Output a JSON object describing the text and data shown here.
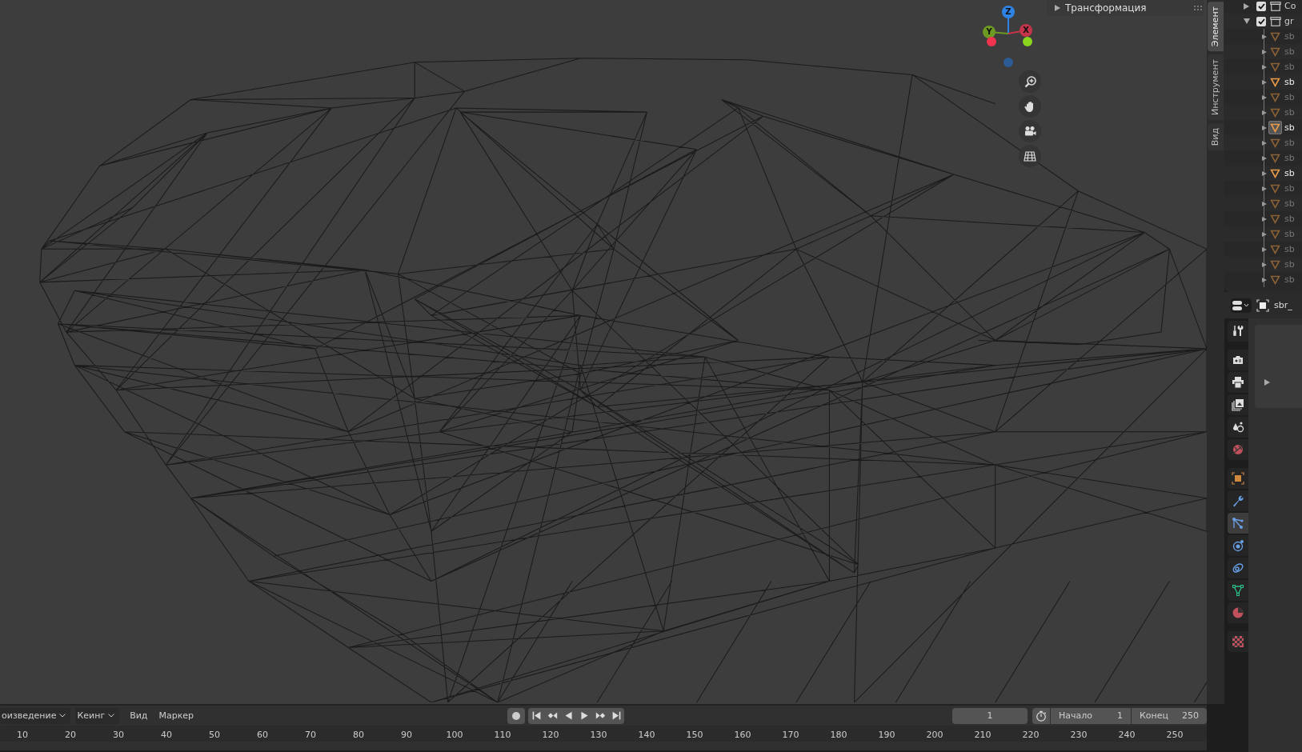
{
  "viewport": {
    "panel": {
      "title": "Трансформация",
      "expanded": false
    },
    "gizmo_axes": [
      {
        "label": "Z",
        "color": "#2f83e4"
      },
      {
        "label": "Y",
        "color": "#6c9a23"
      },
      {
        "label": "X",
        "color": "#c4354b"
      }
    ]
  },
  "sidebar_tabs": [
    {
      "label": "Элемент",
      "selected": true
    },
    {
      "label": "Инструмент",
      "selected": false
    },
    {
      "label": "Вид",
      "selected": false
    }
  ],
  "outliner": {
    "items": [
      {
        "name": "Co",
        "kind": "collection",
        "checked": true,
        "expanded": false
      },
      {
        "name": "gr",
        "kind": "collection",
        "checked": true,
        "expanded": true,
        "children": [
          {
            "name": "sb",
            "kind": "mesh",
            "selected": false,
            "active": false
          },
          {
            "name": "sb",
            "kind": "mesh",
            "selected": false,
            "active": false
          },
          {
            "name": "sb",
            "kind": "mesh",
            "selected": false,
            "active": false
          },
          {
            "name": "sb",
            "kind": "mesh",
            "selected": true,
            "active": false
          },
          {
            "name": "sb",
            "kind": "mesh",
            "selected": false,
            "active": false
          },
          {
            "name": "sb",
            "kind": "mesh",
            "selected": false,
            "active": false
          },
          {
            "name": "sb",
            "kind": "mesh",
            "selected": true,
            "active": true
          },
          {
            "name": "sb",
            "kind": "mesh",
            "selected": false,
            "active": false
          },
          {
            "name": "sb",
            "kind": "mesh",
            "selected": false,
            "active": false
          },
          {
            "name": "sb",
            "kind": "mesh",
            "selected": true,
            "active": false
          },
          {
            "name": "sb",
            "kind": "mesh",
            "selected": false,
            "active": false
          },
          {
            "name": "sb",
            "kind": "mesh",
            "selected": false,
            "active": false
          },
          {
            "name": "sb",
            "kind": "mesh",
            "selected": false,
            "active": false
          },
          {
            "name": "sb",
            "kind": "mesh",
            "selected": false,
            "active": false
          },
          {
            "name": "sb",
            "kind": "mesh",
            "selected": false,
            "active": false
          },
          {
            "name": "sb",
            "kind": "mesh",
            "selected": false,
            "active": false
          },
          {
            "name": "sb",
            "kind": "mesh",
            "selected": false,
            "active": false
          }
        ]
      }
    ]
  },
  "properties": {
    "object_name": "sbr_",
    "panel_expanded": false,
    "tabs": [
      {
        "kind": "tool",
        "selected": false
      },
      {
        "kind": "render",
        "selected": false
      },
      {
        "kind": "output",
        "selected": false
      },
      {
        "kind": "view_layer",
        "selected": false
      },
      {
        "kind": "scene",
        "selected": false
      },
      {
        "kind": "world",
        "selected": false
      },
      {
        "kind": "object",
        "selected": false
      },
      {
        "kind": "modifier",
        "selected": false
      },
      {
        "kind": "particles",
        "selected": true
      },
      {
        "kind": "physics",
        "selected": false
      },
      {
        "kind": "constraints",
        "selected": false
      },
      {
        "kind": "data",
        "selected": false
      },
      {
        "kind": "material",
        "selected": false
      },
      {
        "kind": "texture",
        "selected": false
      }
    ]
  },
  "timeline": {
    "menus": [
      {
        "label": "оизведение",
        "kind": "dropdown"
      },
      {
        "label": "Кеинг",
        "kind": "dropdown"
      },
      {
        "label": "Вид",
        "kind": "menu"
      },
      {
        "label": "Маркер",
        "kind": "menu"
      }
    ],
    "auto_keying": false,
    "current_frame": "1",
    "start_label": "Начало",
    "start": "1",
    "end_label": "Конец",
    "end": "250",
    "ruler": [
      "10",
      "20",
      "30",
      "40",
      "50",
      "60",
      "70",
      "80",
      "90",
      "100",
      "110",
      "120",
      "130",
      "140",
      "150",
      "160",
      "170",
      "180",
      "190",
      "200",
      "210",
      "220",
      "230",
      "240",
      "250"
    ]
  }
}
